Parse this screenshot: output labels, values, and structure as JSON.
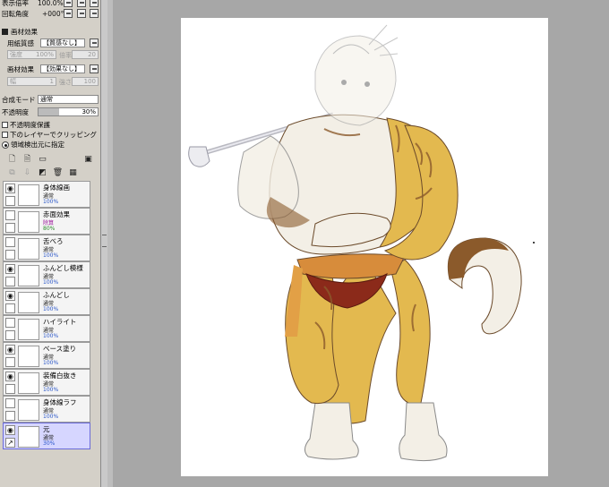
{
  "panel": {
    "display_label": "表示倍率",
    "display_value": "100.0%",
    "rotation_label": "回転角度",
    "rotation_value": "+000°",
    "section_title": "画材効果",
    "paper_texture_label": "用紙質感",
    "paper_texture_value": "【質感なし】",
    "paper_intensity_placeholder": "強度",
    "paper_intensity_value": "100%",
    "paper_scale_label": "倍率",
    "paper_scale_value": "20",
    "material_label": "画材効果",
    "material_value": "【効果なし】",
    "material_width_label": "幅",
    "material_width_value": "1",
    "material_strength_label": "強さ",
    "material_strength_value": "100",
    "blend_mode_label": "合成モード",
    "blend_mode_value": "通常",
    "opacity_label": "不透明度",
    "opacity_value": "30%",
    "checkbox_protect_opacity": "不透明度保護",
    "checkbox_clipping": "下のレイヤーでクリッピング",
    "radio_selection_source": "領域検出元に指定"
  },
  "layers": [
    {
      "name": "身体線画",
      "mode": "通常",
      "opacity": "100%",
      "visible": true
    },
    {
      "name": "赤面効果",
      "mode": "除算",
      "opacity": "80%",
      "visible": false
    },
    {
      "name": "舌べろ",
      "mode": "通常",
      "opacity": "100%",
      "visible": false
    },
    {
      "name": "ふんどし模様",
      "mode": "通常",
      "opacity": "100%",
      "visible": true
    },
    {
      "name": "ふんどし",
      "mode": "通常",
      "opacity": "100%",
      "visible": true
    },
    {
      "name": "ハイライト",
      "mode": "通常",
      "opacity": "100%",
      "visible": false
    },
    {
      "name": "ベース塗り",
      "mode": "通常",
      "opacity": "100%",
      "visible": true
    },
    {
      "name": "装備白抜き",
      "mode": "通常",
      "opacity": "100%",
      "visible": true
    },
    {
      "name": "身体線ラフ",
      "mode": "通常",
      "opacity": "100%",
      "visible": false
    },
    {
      "name": "元",
      "mode": "通常",
      "opacity": "30%",
      "visible": true,
      "selected": true
    }
  ],
  "colors": {
    "panel_bg": "#d4d0c8",
    "workspace_bg": "#a7a7a7",
    "selected_layer": "#d6d6ff",
    "fur_gold": "#e3b94f",
    "fur_brown": "#8b5a2b",
    "fur_white": "#f3efe6"
  }
}
